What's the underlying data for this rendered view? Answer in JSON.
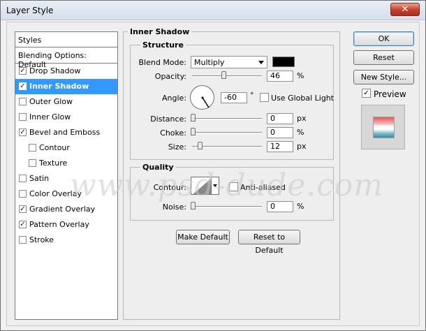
{
  "window": {
    "title": "Layer Style",
    "close_label": "✕"
  },
  "styles_panel": {
    "header": "Styles",
    "blending": "Blending Options: Default",
    "items": [
      {
        "label": "Drop Shadow",
        "checked": true,
        "sub": false,
        "selected": false
      },
      {
        "label": "Inner Shadow",
        "checked": true,
        "sub": false,
        "selected": true
      },
      {
        "label": "Outer Glow",
        "checked": false,
        "sub": false,
        "selected": false
      },
      {
        "label": "Inner Glow",
        "checked": false,
        "sub": false,
        "selected": false
      },
      {
        "label": "Bevel and Emboss",
        "checked": true,
        "sub": false,
        "selected": false
      },
      {
        "label": "Contour",
        "checked": false,
        "sub": true,
        "selected": false
      },
      {
        "label": "Texture",
        "checked": false,
        "sub": true,
        "selected": false
      },
      {
        "label": "Satin",
        "checked": false,
        "sub": false,
        "selected": false
      },
      {
        "label": "Color Overlay",
        "checked": false,
        "sub": false,
        "selected": false
      },
      {
        "label": "Gradient Overlay",
        "checked": true,
        "sub": false,
        "selected": false
      },
      {
        "label": "Pattern Overlay",
        "checked": true,
        "sub": false,
        "selected": false
      },
      {
        "label": "Stroke",
        "checked": false,
        "sub": false,
        "selected": false
      }
    ]
  },
  "inner_shadow": {
    "title": "Inner Shadow",
    "structure": {
      "title": "Structure",
      "blend_mode_label": "Blend Mode:",
      "blend_mode_value": "Multiply",
      "color": "#000000",
      "opacity_label": "Opacity:",
      "opacity_value": "46",
      "opacity_unit": "%",
      "angle_label": "Angle:",
      "angle_value": "-60",
      "angle_unit": "°",
      "global_light_label": "Use Global Light",
      "global_light_checked": false,
      "distance_label": "Distance:",
      "distance_value": "0",
      "distance_unit": "px",
      "choke_label": "Choke:",
      "choke_value": "0",
      "choke_unit": "%",
      "size_label": "Size:",
      "size_value": "12",
      "size_unit": "px"
    },
    "quality": {
      "title": "Quality",
      "contour_label": "Contour:",
      "anti_aliased_label": "Anti-aliased",
      "anti_aliased_checked": false,
      "noise_label": "Noise:",
      "noise_value": "0",
      "noise_unit": "%"
    },
    "make_default_label": "Make Default",
    "reset_to_default_label": "Reset to Default"
  },
  "actions": {
    "ok_label": "OK",
    "reset_label": "Reset",
    "new_style_label": "New Style...",
    "preview_label": "Preview",
    "preview_checked": true
  },
  "watermark": "www.psd-dude.com"
}
